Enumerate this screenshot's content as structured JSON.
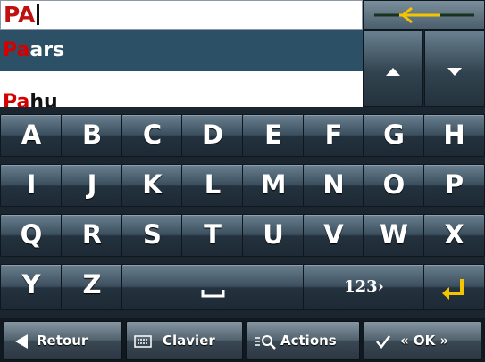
{
  "search": {
    "value": "PA"
  },
  "results": [
    {
      "match": "Pa",
      "rest": "ars"
    },
    {
      "match": "Pa",
      "rest": "hu"
    }
  ],
  "keyboard": {
    "rows": [
      [
        "A",
        "B",
        "C",
        "D",
        "E",
        "F",
        "G",
        "H"
      ],
      [
        "I",
        "J",
        "K",
        "L",
        "M",
        "N",
        "O",
        "P"
      ],
      [
        "Q",
        "R",
        "S",
        "T",
        "U",
        "V",
        "W",
        "X"
      ],
      [
        "Y",
        "Z"
      ]
    ],
    "numeric_label": "123›"
  },
  "toolbar": {
    "back_label": "Retour",
    "keyboard_label": "Clavier",
    "actions_label": "Actions",
    "ok_label": "« OK »"
  },
  "colors": {
    "match_red": "#d40000",
    "backspace_arrow": "#f5c400",
    "enter_arrow": "#f5c400",
    "selected_row": "#2c5166"
  },
  "icons": {
    "backspace": "backspace-arrow-icon",
    "up": "scroll-up-icon",
    "down": "scroll-down-icon",
    "enter": "enter-icon",
    "back": "back-triangle-icon",
    "keyboard": "keyboard-icon",
    "actions": "actions-magnifier-icon",
    "ok": "checkmark-icon"
  }
}
